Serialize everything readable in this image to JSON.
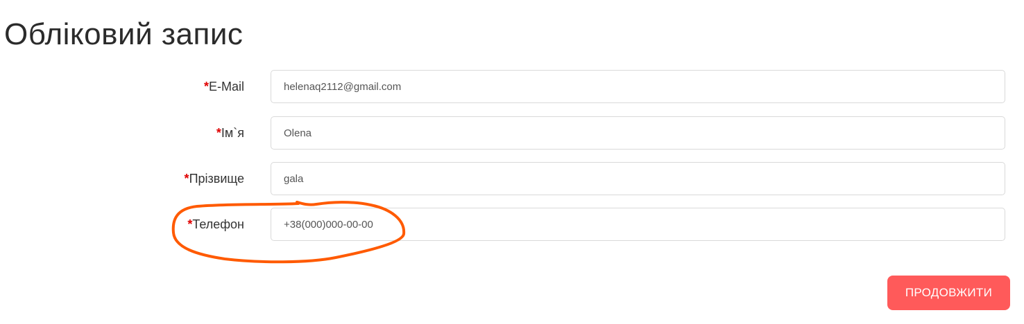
{
  "page": {
    "title": "Обліковий запис"
  },
  "form": {
    "required_mark": "*",
    "fields": [
      {
        "label": "E-Mail",
        "value": "helenaq2112@gmail.com"
      },
      {
        "label": "Ім`я",
        "value": "Olena"
      },
      {
        "label": "Прізвище",
        "value": "gala"
      },
      {
        "label": "Телефон",
        "value": "+38(000)000-00-00"
      }
    ]
  },
  "annotation": {
    "color": "#ff5a00"
  },
  "actions": {
    "continue_label": "ПРОДОВЖИТИ",
    "continue_color": "#ff5a5a"
  }
}
